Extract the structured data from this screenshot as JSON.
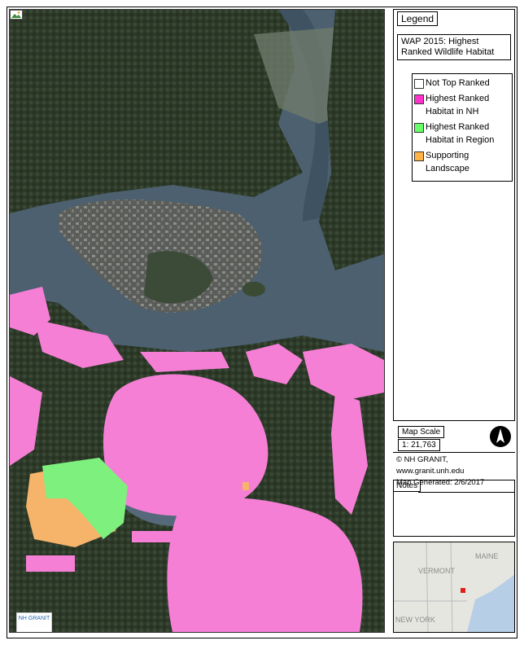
{
  "legend": {
    "title": "Legend",
    "layer_title": "WAP 2015: Highest Ranked Wildlife Habitat",
    "items": [
      {
        "label": "Not Top Ranked",
        "color": "#ffffff"
      },
      {
        "label": "Highest Ranked Habitat in NH",
        "color": "#ff33cc"
      },
      {
        "label": "Highest Ranked Habitat in Region",
        "color": "#66ff66"
      },
      {
        "label": "Supporting Landscape",
        "color": "#ffb347"
      }
    ]
  },
  "scale": {
    "label": "Map Scale",
    "value": "1: 21,763"
  },
  "credit": "© NH GRANIT, www.granit.unh.edu",
  "generated": "Map Generated:  2/6/2017",
  "notes_label": "Notes",
  "logo_text": "NH GRANIT",
  "inset": {
    "labels": [
      "VERMONT",
      "MAINE",
      "NEW YORK"
    ]
  },
  "colors": {
    "habitat_nh": "#f67fd6",
    "habitat_region": "#7ef07e",
    "supporting": "#f6b46a",
    "water": "#4f6273",
    "land_dark": "#2f3b2d"
  }
}
